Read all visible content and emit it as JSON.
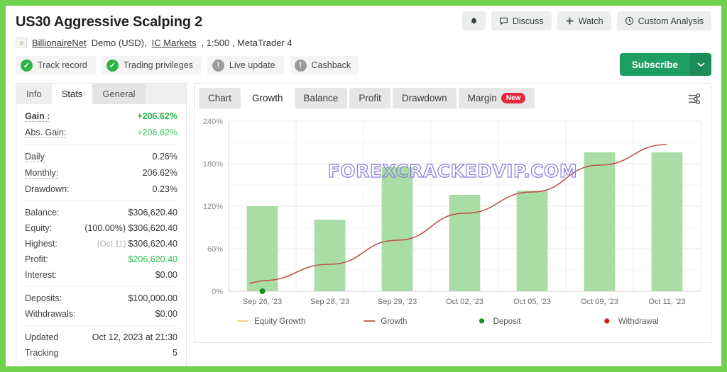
{
  "header": {
    "title": "US30 Aggressive Scalping 2",
    "meta": {
      "author": "BillionaireNet",
      "account_type": "Demo (USD),",
      "broker": "IC Markets",
      "leverage": ", 1:500 , MetaTrader 4"
    },
    "actions": [
      {
        "name": "notifications-button",
        "icon": "bell-icon",
        "label": ""
      },
      {
        "name": "discuss-button",
        "icon": "comment-icon",
        "label": "Discuss"
      },
      {
        "name": "watch-button",
        "icon": "plus-icon",
        "label": "Watch"
      },
      {
        "name": "custom-analysis-button",
        "icon": "clock-icon",
        "label": "Custom Analysis"
      }
    ],
    "badges": [
      {
        "label": "Track record",
        "state": "ok"
      },
      {
        "label": "Trading privileges",
        "state": "ok"
      },
      {
        "label": "Live update",
        "state": "warn"
      },
      {
        "label": "Cashback",
        "state": "warn"
      }
    ],
    "subscribe_label": "Subscribe",
    "subscribe_caret": "❯"
  },
  "left_panel": {
    "tabs": [
      {
        "label": "Info",
        "active": false
      },
      {
        "label": "Stats",
        "active": true
      },
      {
        "label": "General",
        "active": false
      }
    ],
    "groups": [
      {
        "rows": [
          {
            "key": "Gain :",
            "value": "+206.62%",
            "style": "green",
            "key_style": "dotted-bold"
          },
          {
            "key": "Abs. Gain:",
            "value": "+206.62%",
            "style": "green-plain",
            "key_style": "dotted"
          }
        ]
      },
      {
        "rows": [
          {
            "key": "Daily",
            "value": "0.26%",
            "style": "",
            "key_style": "dotted"
          },
          {
            "key": "Monthly:",
            "value": "206.62%",
            "style": "",
            "key_style": "dotted"
          },
          {
            "key": "Drawdown:",
            "value": "0.23%",
            "style": "",
            "key_style": ""
          }
        ]
      },
      {
        "rows": [
          {
            "key": "Balance:",
            "value": "$306,620.40",
            "style": "",
            "key_style": ""
          },
          {
            "key": "Equity:",
            "value": "$306,620.40",
            "prefix": "(100.00%)",
            "style": "",
            "key_style": ""
          },
          {
            "key": "Highest:",
            "value": "$306,620.40",
            "prefix": "(Oct 11)",
            "style": "",
            "key_style": ""
          },
          {
            "key": "Profit:",
            "value": "$206,620.40",
            "style": "profit",
            "key_style": ""
          },
          {
            "key": "Interest:",
            "value": "$0.00",
            "style": "",
            "key_style": ""
          }
        ]
      },
      {
        "rows": [
          {
            "key": "Deposits:",
            "value": "$100,000.00",
            "style": "",
            "key_style": ""
          },
          {
            "key": "Withdrawals:",
            "value": "$0.00",
            "style": "",
            "key_style": ""
          }
        ]
      },
      {
        "rows": [
          {
            "key": "Updated",
            "value": "Oct 12, 2023 at 21:30",
            "style": "",
            "key_style": ""
          },
          {
            "key": "Tracking",
            "value": "5",
            "style": "",
            "key_style": ""
          }
        ]
      }
    ]
  },
  "chart_panel": {
    "tabs": [
      {
        "label": "Chart",
        "active": false,
        "badge": ""
      },
      {
        "label": "Growth",
        "active": true,
        "badge": ""
      },
      {
        "label": "Balance",
        "active": false,
        "badge": ""
      },
      {
        "label": "Profit",
        "active": false,
        "badge": ""
      },
      {
        "label": "Drawdown",
        "active": false,
        "badge": ""
      },
      {
        "label": "Margin",
        "active": false,
        "badge": "New"
      }
    ],
    "settings_icon": "sliders-icon",
    "watermark": "FOREXCRACKEDVIP.COM"
  },
  "chart_data": {
    "type": "bar",
    "title": "Growth",
    "xlabel": "",
    "ylabel": "",
    "ylim": [
      0,
      240
    ],
    "yticks": [
      0,
      60,
      120,
      180,
      240
    ],
    "ytick_labels": [
      "0%",
      "60%",
      "120%",
      "180%",
      "240%"
    ],
    "grid": true,
    "categories": [
      "Sep 26, '23",
      "Sep 28, '23",
      "Sep 29, '23",
      "Oct 02, '23",
      "Oct 05, '23",
      "Oct 09, '23",
      "Oct 11, '23"
    ],
    "series": [
      {
        "name": "Equity Growth",
        "type": "bar",
        "color": "#a9dda5",
        "values": [
          120,
          101,
          175,
          136,
          142,
          196,
          196
        ]
      },
      {
        "name": "Growth",
        "type": "line",
        "color": "#c0504d",
        "values": [
          15,
          38,
          72,
          110,
          140,
          178,
          207
        ]
      }
    ],
    "markers": [
      {
        "name": "Deposit",
        "color": "#1a8f1a",
        "category": "Sep 26, '23",
        "value": 0
      }
    ],
    "legend": [
      {
        "label": "Equity Growth",
        "color": "#f5c96b",
        "shape": "line"
      },
      {
        "label": "Growth",
        "color": "#c0504d",
        "shape": "line"
      },
      {
        "label": "Deposit",
        "color": "#1a8f1a",
        "shape": "dot"
      },
      {
        "label": "Withdrawal",
        "color": "#c81e1e",
        "shape": "dot"
      }
    ],
    "legend_position": "bottom"
  },
  "colors": {
    "frame": "#6fd14e",
    "accent_green": "#1f9e63",
    "bar": "#a9dda5",
    "line": "#c0504d",
    "positive": "#27b348"
  }
}
